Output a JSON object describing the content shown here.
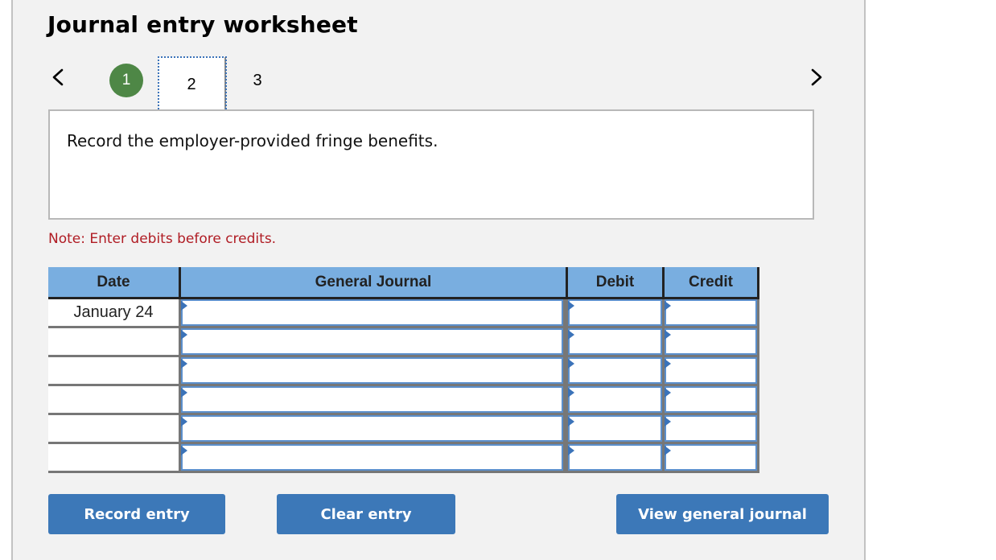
{
  "worksheet": {
    "title": "Journal entry worksheet",
    "nav": {
      "prev_icon": "chevron-left-icon",
      "next_icon": "chevron-right-icon"
    },
    "steps": [
      {
        "label": "1",
        "state": "completed",
        "color": "#4e8746"
      },
      {
        "label": "2",
        "state": "current"
      },
      {
        "label": "3",
        "state": "upcoming"
      }
    ],
    "prompt": "Record the employer-provided fringe benefits.",
    "note": "Note: Enter debits before credits.",
    "note_color": "#b01c24"
  },
  "journal": {
    "headers": {
      "date": "Date",
      "general_journal": "General Journal",
      "debit": "Debit",
      "credit": "Credit"
    },
    "header_color": "#79aee0",
    "rows": [
      {
        "date": "January 24",
        "account": "",
        "debit": "",
        "credit": ""
      },
      {
        "date": "",
        "account": "",
        "debit": "",
        "credit": ""
      },
      {
        "date": "",
        "account": "",
        "debit": "",
        "credit": ""
      },
      {
        "date": "",
        "account": "",
        "debit": "",
        "credit": ""
      },
      {
        "date": "",
        "account": "",
        "debit": "",
        "credit": ""
      },
      {
        "date": "",
        "account": "",
        "debit": "",
        "credit": ""
      }
    ]
  },
  "buttons": {
    "record": "Record entry",
    "clear": "Clear entry",
    "view": "View general journal",
    "color": "#3c78b8"
  }
}
